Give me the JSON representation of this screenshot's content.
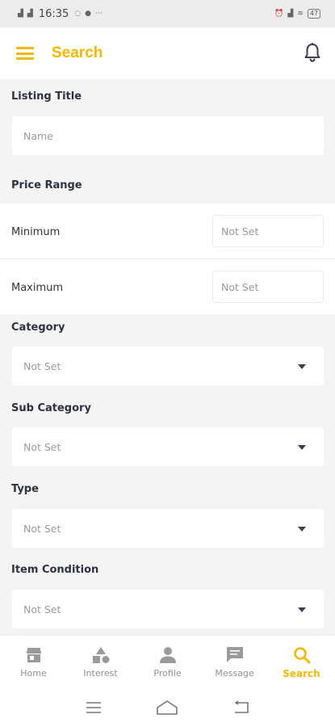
{
  "status_bar": {
    "time": "16:35",
    "battery": "47"
  },
  "header": {
    "title": "Search"
  },
  "form": {
    "listing_title": {
      "label": "Listing Title",
      "placeholder": "Name"
    },
    "price_range": {
      "label": "Price Range",
      "minimum_label": "Minimum",
      "minimum_placeholder": "Not Set",
      "maximum_label": "Maximum",
      "maximum_placeholder": "Not Set"
    },
    "category": {
      "label": "Category",
      "value": "Not Set"
    },
    "sub_category": {
      "label": "Sub Category",
      "value": "Not Set"
    },
    "type": {
      "label": "Type",
      "value": "Not Set"
    },
    "item_condition": {
      "label": "Item Condition",
      "value": "Not Set"
    }
  },
  "bottom_nav": {
    "items": [
      {
        "label": "Home",
        "icon": "home-icon"
      },
      {
        "label": "Interest",
        "icon": "shapes-icon"
      },
      {
        "label": "Profile",
        "icon": "person-icon"
      },
      {
        "label": "Message",
        "icon": "chat-icon"
      },
      {
        "label": "Search",
        "icon": "search-icon",
        "active": true
      }
    ]
  },
  "colors": {
    "accent": "#f5b800",
    "background": "#f4f4f4",
    "text": "#2d3142"
  }
}
